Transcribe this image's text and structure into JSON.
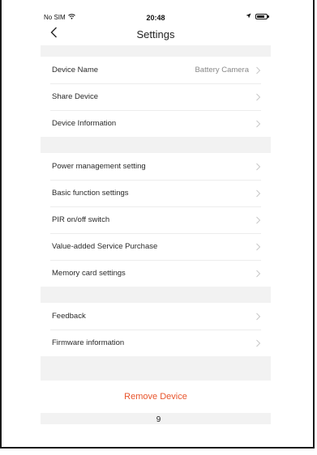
{
  "status_bar": {
    "carrier": "No SIM",
    "time": "20:48",
    "icons": [
      "wifi-icon",
      "location-arrow-icon",
      "battery-icon"
    ]
  },
  "nav": {
    "back_icon": "chevron-left-icon",
    "title": "Settings"
  },
  "groups": [
    {
      "rows": [
        {
          "label": "Device Name",
          "value": "Battery Camera"
        },
        {
          "label": "Share Device",
          "value": ""
        },
        {
          "label": "Device Information",
          "value": ""
        }
      ]
    },
    {
      "rows": [
        {
          "label": "Power management setting",
          "value": ""
        },
        {
          "label": "Basic function settings",
          "value": ""
        },
        {
          "label": "PIR on/off switch",
          "value": ""
        },
        {
          "label": "Value-added Service Purchase",
          "value": ""
        },
        {
          "label": "Memory card settings",
          "value": ""
        }
      ]
    },
    {
      "rows": [
        {
          "label": "Feedback",
          "value": ""
        },
        {
          "label": "Firmware information",
          "value": ""
        }
      ]
    }
  ],
  "remove_device_label": "Remove Device",
  "colors": {
    "accent": "#e8542b",
    "section_gap": "#f2f2f2"
  },
  "page_number": "9"
}
